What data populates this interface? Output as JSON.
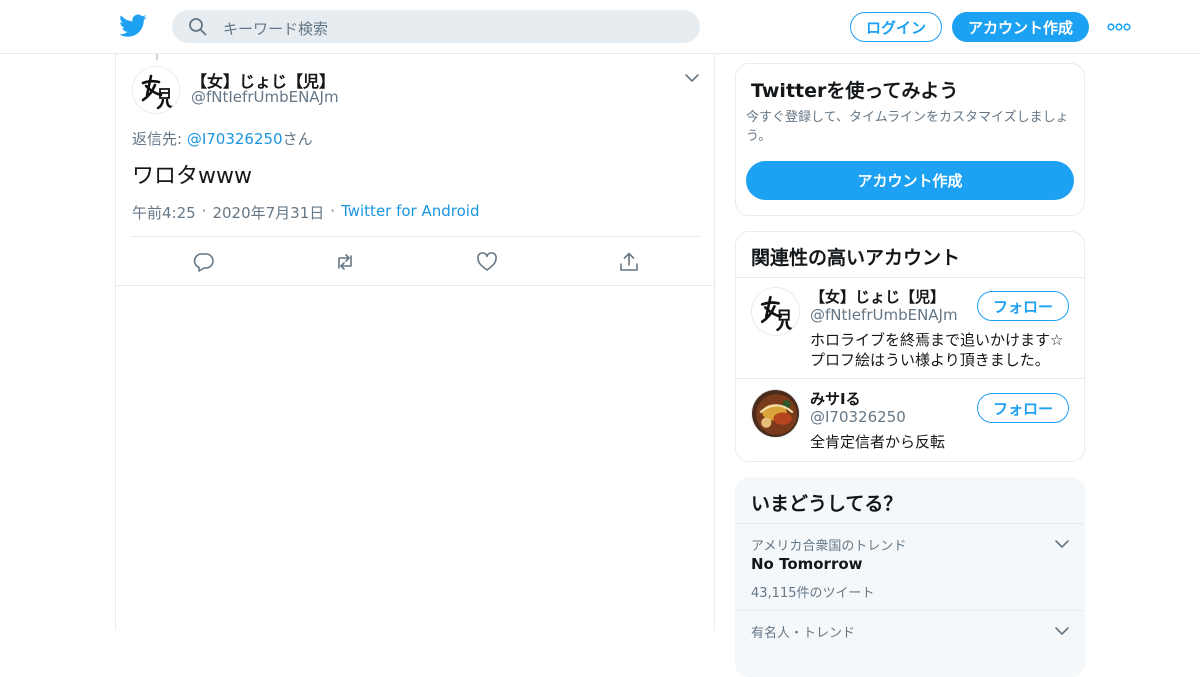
{
  "header": {
    "search_placeholder": "キーワード検索",
    "login_label": "ログイン",
    "signup_label": "アカウント作成"
  },
  "tweet": {
    "author_name": "【女】じょじ【児】",
    "author_handle": "@fNtIefrUmbENAJm",
    "reply_prefix": "返信先: ",
    "reply_mention": "@I70326250",
    "reply_suffix": "さん",
    "text": "ワロタwww",
    "time": "午前4:25",
    "date": "2020年7月31日",
    "source": "Twitter for Android",
    "separator": "·"
  },
  "signup_card": {
    "heading": "Twitterを使ってみよう",
    "description": "今すぐ登録して、タイムラインをカスタマイズしましょう。",
    "button_label": "アカウント作成"
  },
  "related": {
    "heading": "関連性の高いアカウント",
    "accounts": [
      {
        "name": "【女】じょじ【児】",
        "handle": "@fNtIefrUmbENAJm",
        "bio": "ホロライブを終焉まで追いかけます☆プロフ絵はうい様より頂きました。",
        "follow_label": "フォロー"
      },
      {
        "name": "みサIる",
        "handle": "@I70326250",
        "bio": "全肯定信者から反転",
        "follow_label": "フォロー"
      }
    ]
  },
  "trends": {
    "heading": "いまどうしてる？",
    "items": [
      {
        "context": "アメリカ合衆国のトレンド",
        "title": "No Tomorrow",
        "count": "43,115件のツイート"
      },
      {
        "context": "有名人・トレンド"
      }
    ]
  },
  "colors": {
    "accent": "#1da1f2",
    "link": "#1b95e0",
    "muted": "#657786",
    "border": "#e6ecf0"
  }
}
